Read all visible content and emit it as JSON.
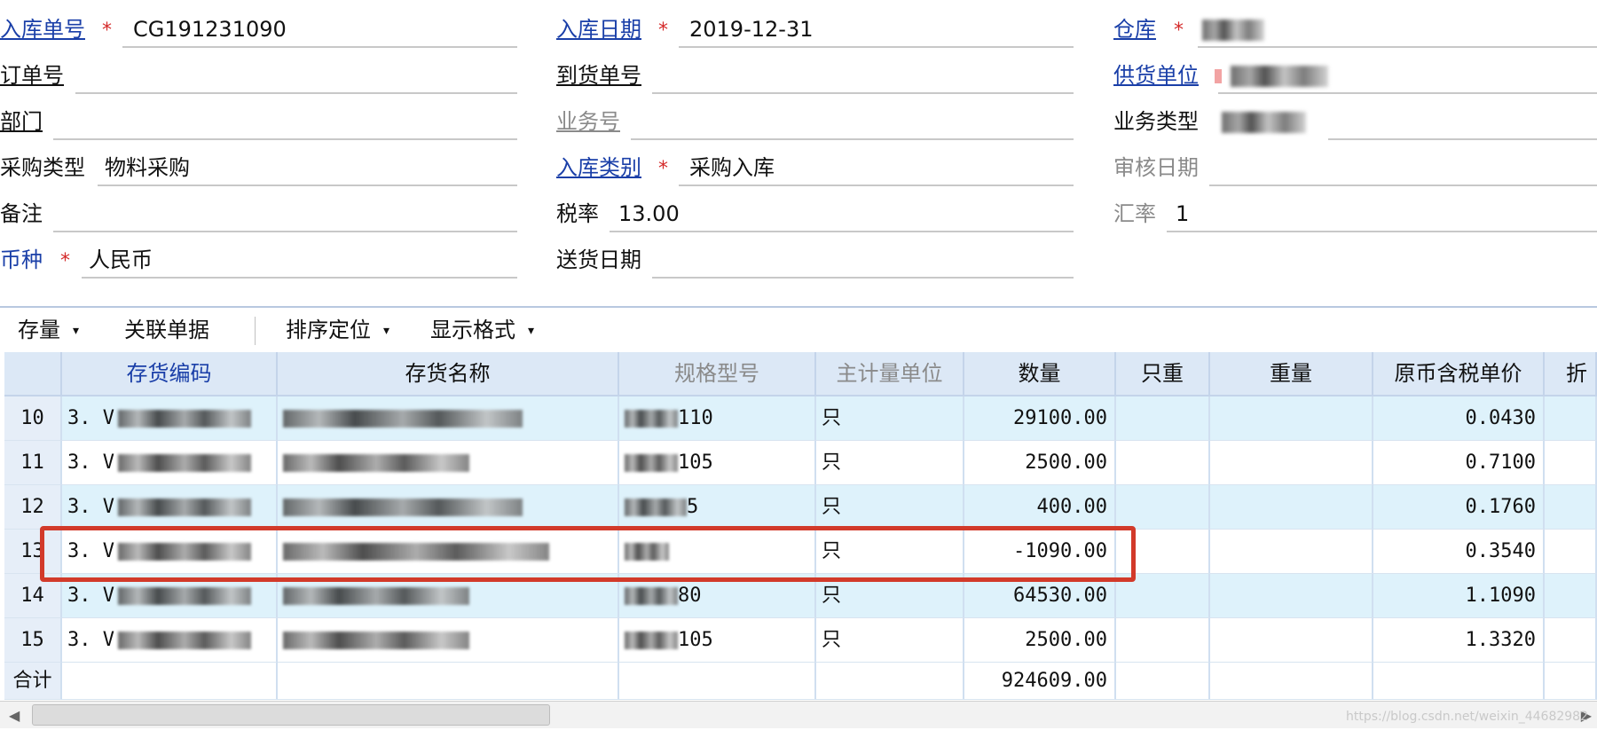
{
  "form": {
    "entry_no": {
      "label": "入库单号",
      "value": "CG191231090"
    },
    "entry_date": {
      "label": "入库日期",
      "value": "2019-12-31"
    },
    "warehouse": {
      "label": "仓库"
    },
    "order_no": {
      "label": "订单号",
      "value": ""
    },
    "arrival_no": {
      "label": "到货单号",
      "value": ""
    },
    "supplier": {
      "label": "供货单位"
    },
    "department": {
      "label": "部门",
      "value": ""
    },
    "business_no": {
      "label": "业务号",
      "value": ""
    },
    "business_type": {
      "label": "业务类型"
    },
    "purchase_type": {
      "label": "采购类型",
      "value": "物料采购"
    },
    "entry_category": {
      "label": "入库类别",
      "value": "采购入库"
    },
    "audit_date": {
      "label": "审核日期",
      "value": ""
    },
    "remark": {
      "label": "备注",
      "value": ""
    },
    "tax_rate": {
      "label": "税率",
      "value": "13.00"
    },
    "exchange_rate": {
      "label": "汇率",
      "value": "1"
    },
    "currency": {
      "label": "币种",
      "value": "人民币"
    },
    "delivery_date": {
      "label": "送货日期",
      "value": ""
    },
    "required_mark": "*"
  },
  "toolbar": {
    "stock": "存量",
    "related_docs": "关联单据",
    "sort_locate": "排序定位",
    "display_format": "显示格式",
    "dropdown_glyph": "▾"
  },
  "table": {
    "columns": [
      "",
      "存货编码",
      "存货名称",
      "规格型号",
      "主计量单位",
      "数量",
      "只重",
      "重量",
      "原币含税单价",
      "折"
    ],
    "rows": [
      {
        "no": "10",
        "code_prefix": "3. V",
        "spec_suffix": "110",
        "unit": "只",
        "qty": "29100.00",
        "unit_weight": "",
        "weight": "",
        "price": "0.0430"
      },
      {
        "no": "11",
        "code_prefix": "3. V",
        "spec_suffix": "105",
        "unit": "只",
        "qty": "2500.00",
        "unit_weight": "",
        "weight": "",
        "price": "0.7100"
      },
      {
        "no": "12",
        "code_prefix": "3. V",
        "spec_suffix": "5",
        "unit": "只",
        "qty": "400.00",
        "unit_weight": "",
        "weight": "",
        "price": "0.1760"
      },
      {
        "no": "13",
        "code_prefix": "3. V",
        "spec_suffix": "",
        "unit": "只",
        "qty": "-1090.00",
        "unit_weight": "",
        "weight": "",
        "price": "0.3540"
      },
      {
        "no": "14",
        "code_prefix": "3. V",
        "spec_suffix": "80",
        "unit": "只",
        "qty": "64530.00",
        "unit_weight": "",
        "weight": "",
        "price": "1.1090"
      },
      {
        "no": "15",
        "code_prefix": "3. V",
        "spec_suffix": "105",
        "unit": "只",
        "qty": "2500.00",
        "unit_weight": "",
        "weight": "",
        "price": "1.3320"
      }
    ],
    "total_label": "合计",
    "total_qty": "924609.00"
  },
  "watermark": "https://blog.csdn.net/weixin_44682982",
  "colors": {
    "link": "#1a3fa8",
    "required": "#d42a2a",
    "highlight_box": "#d23a2a",
    "header_bg": "#dce8f6",
    "alt_row_bg": "#def2fb"
  }
}
